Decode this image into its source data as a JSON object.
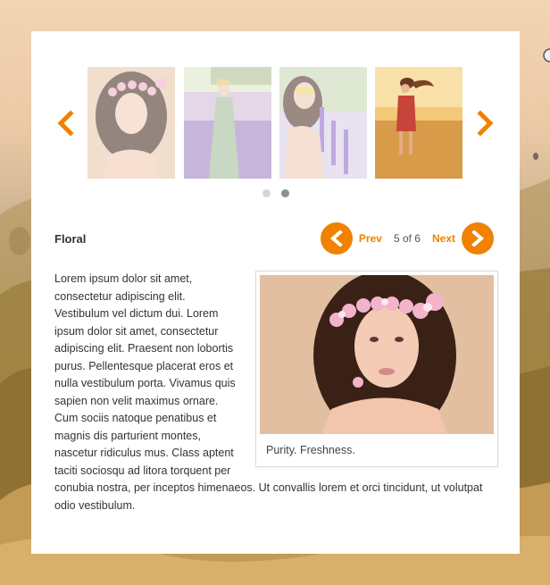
{
  "carousel": {
    "prev_icon": "chevron-left-icon",
    "next_icon": "chevron-right-icon",
    "thumbnails": [
      {
        "subject": "woman-with-flower-crown"
      },
      {
        "subject": "woman-in-lavender-field"
      },
      {
        "subject": "woman-with-lavender-flowers"
      },
      {
        "subject": "woman-in-wheat-field"
      }
    ],
    "dots": 2,
    "active_dot": 1
  },
  "gallery": {
    "title": "Floral",
    "prev_label": "Prev",
    "next_label": "Next",
    "counter": "5 of 6"
  },
  "content": {
    "paragraph": "Lorem ipsum dolor sit amet, consectetur adipiscing elit. Vestibulum vel dictum dui. Lorem ipsum dolor sit amet, consectetur adipiscing elit. Praesent non lobortis purus. Pellentesque placerat eros et nulla vestibulum porta. Vivamus quis sapien non velit maximus ornare. Cum sociis natoque penatibus et magnis dis parturient montes, nascetur ridiculus mus. Class aptent taciti sociosqu ad litora torquent per conubia nostra, per inceptos himenaeos. Ut convallis lorem et orci tincidunt, ut volutpat odio vestibulum.",
    "figure_caption": "Purity. Freshness."
  },
  "colors": {
    "accent": "#f08200",
    "dot_inactive": "#d5d5d5",
    "dot_active": "#87958f"
  }
}
